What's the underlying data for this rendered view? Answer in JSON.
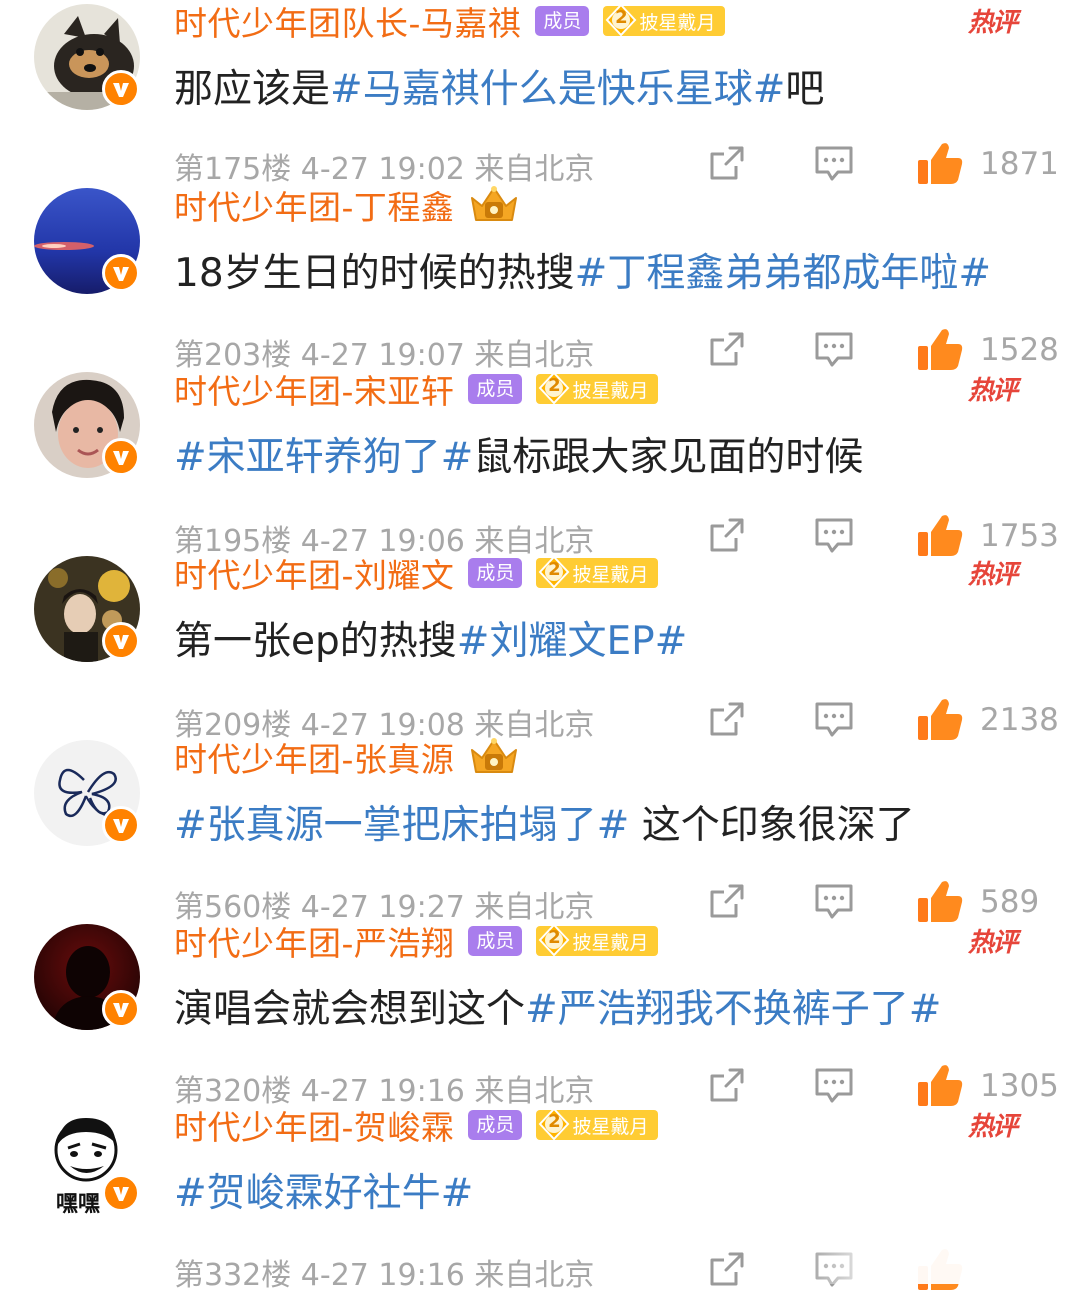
{
  "labels": {
    "hot": "热评",
    "member": "成员"
  },
  "colors": {
    "username": "#f26c14",
    "hashtag": "#3b7cc4",
    "meta": "#a7a7a7",
    "hot": "#e6453a",
    "vbadge": "#ff8200"
  },
  "comments": [
    {
      "username": "时代少年团队长-马嘉祺",
      "badge": "member_star",
      "star_level": "2",
      "star_text": "披星戴月",
      "hot": true,
      "avatar_icon": "shiba-dog-avatar",
      "text_parts": [
        {
          "t": "那应该是",
          "tag": false
        },
        {
          "t": "#马嘉祺什么是快乐星球#",
          "tag": true
        },
        {
          "t": "吧",
          "tag": false
        }
      ],
      "floor": "第175楼 4-27 19:02 来自北京",
      "likes": "1871"
    },
    {
      "username": "时代少年团-丁程鑫",
      "badge": "crown",
      "hot": false,
      "avatar_icon": "blue-sky-avatar",
      "text_parts": [
        {
          "t": "18岁生日的时候的热搜",
          "tag": false
        },
        {
          "t": "#丁程鑫弟弟都成年啦#",
          "tag": true
        }
      ],
      "floor": "第203楼 4-27 19:07 来自北京",
      "likes": "1528"
    },
    {
      "username": "时代少年团-宋亚轩",
      "badge": "member_star",
      "star_level": "2",
      "star_text": "披星戴月",
      "hot": true,
      "avatar_icon": "portrait-avatar",
      "text_parts": [
        {
          "t": "#宋亚轩养狗了#",
          "tag": true
        },
        {
          "t": "鼠标跟大家见面的时候",
          "tag": false
        }
      ],
      "floor": "第195楼 4-27 19:06 来自北京",
      "likes": "1753"
    },
    {
      "username": "时代少年团-刘耀文",
      "badge": "member_star",
      "star_level": "2",
      "star_text": "披星戴月",
      "hot": true,
      "avatar_icon": "night-photo-avatar",
      "text_parts": [
        {
          "t": "第一张ep的热搜",
          "tag": false
        },
        {
          "t": "#刘耀文EP#",
          "tag": true
        }
      ],
      "floor": "第209楼 4-27 19:08 来自北京",
      "likes": "2138"
    },
    {
      "username": "时代少年团-张真源",
      "badge": "crown",
      "hot": false,
      "avatar_icon": "butterfly-doodle-avatar",
      "text_parts": [
        {
          "t": "#张真源一掌把床拍塌了#",
          "tag": true
        },
        {
          "t": " 这个印象很深了",
          "tag": false
        }
      ],
      "floor": "第560楼 4-27 19:27 来自北京",
      "likes": "589"
    },
    {
      "username": "时代少年团-严浩翔",
      "badge": "member_star",
      "star_level": "2",
      "star_text": "披星戴月",
      "hot": true,
      "avatar_icon": "dark-red-avatar",
      "text_parts": [
        {
          "t": "演唱会就会想到这个",
          "tag": false
        },
        {
          "t": "#严浩翔我不换裤子了#",
          "tag": true
        }
      ],
      "floor": "第320楼 4-27 19:16 来自北京",
      "likes": "1305"
    },
    {
      "username": "时代少年团-贺峻霖",
      "badge": "member_star",
      "star_level": "2",
      "star_text": "披星戴月",
      "hot": true,
      "avatar_icon": "meme-face-avatar",
      "avatar_caption": "嘿嘿",
      "text_parts": [
        {
          "t": "#贺峻霖好社牛#",
          "tag": true
        }
      ],
      "floor": "第332楼 4-27 19:16 来自北京",
      "likes": ""
    }
  ]
}
